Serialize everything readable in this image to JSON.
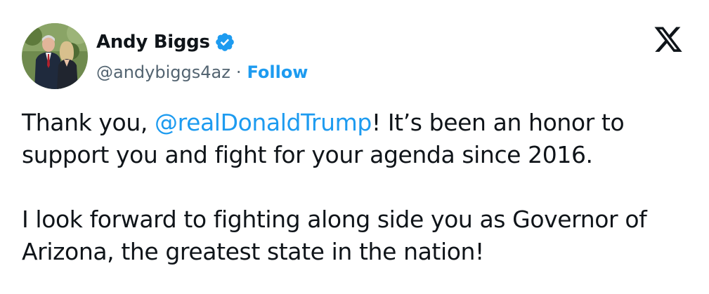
{
  "author": {
    "display_name": "Andy Biggs",
    "handle": "@andybiggs4az",
    "separator": "·",
    "follow_label": "Follow",
    "verified": true
  },
  "post": {
    "p1_before": "Thank you, ",
    "p1_mention": "@realDonaldTrump",
    "p1_after": "! It’s been an honor to support you and fight for your agenda since 2016.",
    "p2": "I look forward to fighting along side you as Governor of Arizona, the greatest state in the nation!"
  },
  "icons": {
    "verified": "verified-badge-icon",
    "platform": "x-logo-icon"
  },
  "colors": {
    "accent": "#1d9bf0",
    "text": "#0f1419",
    "muted": "#536471"
  }
}
